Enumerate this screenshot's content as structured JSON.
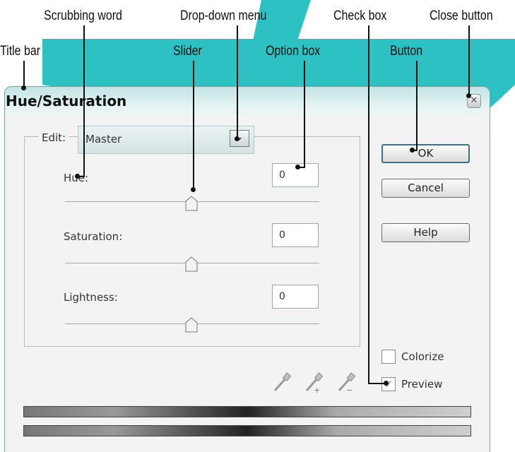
{
  "callouts": {
    "scrubbing_word": "Scrubbing word",
    "dropdown_menu": "Drop-down menu",
    "check_box": "Check box",
    "close_button": "Close button",
    "title_bar": "Title bar",
    "slider": "Slider",
    "option_box": "Option box",
    "button": "Button"
  },
  "dialog": {
    "title": "Hue/Saturation",
    "close_glyph": "✕",
    "edit_label": "Edit:",
    "edit_value": "Master",
    "dropdown_arrow": "⌄",
    "fields": [
      {
        "label": "Hue:",
        "value": "0"
      },
      {
        "label": "Saturation:",
        "value": "0"
      },
      {
        "label": "Lightness:",
        "value": "0"
      }
    ],
    "buttons": {
      "ok": "OK",
      "cancel": "Cancel",
      "help": "Help"
    },
    "colorize": {
      "label": "Colorize",
      "checked": false
    },
    "preview": {
      "label": "Preview",
      "checked": true,
      "glyph": "✓"
    }
  },
  "colors": {
    "accent_teal": "#2ec1c3",
    "title_bar_tint": "#c4e4e5"
  },
  "icons": [
    "close-icon",
    "chevron-down-icon",
    "eyedropper-icon",
    "eyedropper-plus-icon",
    "eyedropper-minus-icon"
  ]
}
